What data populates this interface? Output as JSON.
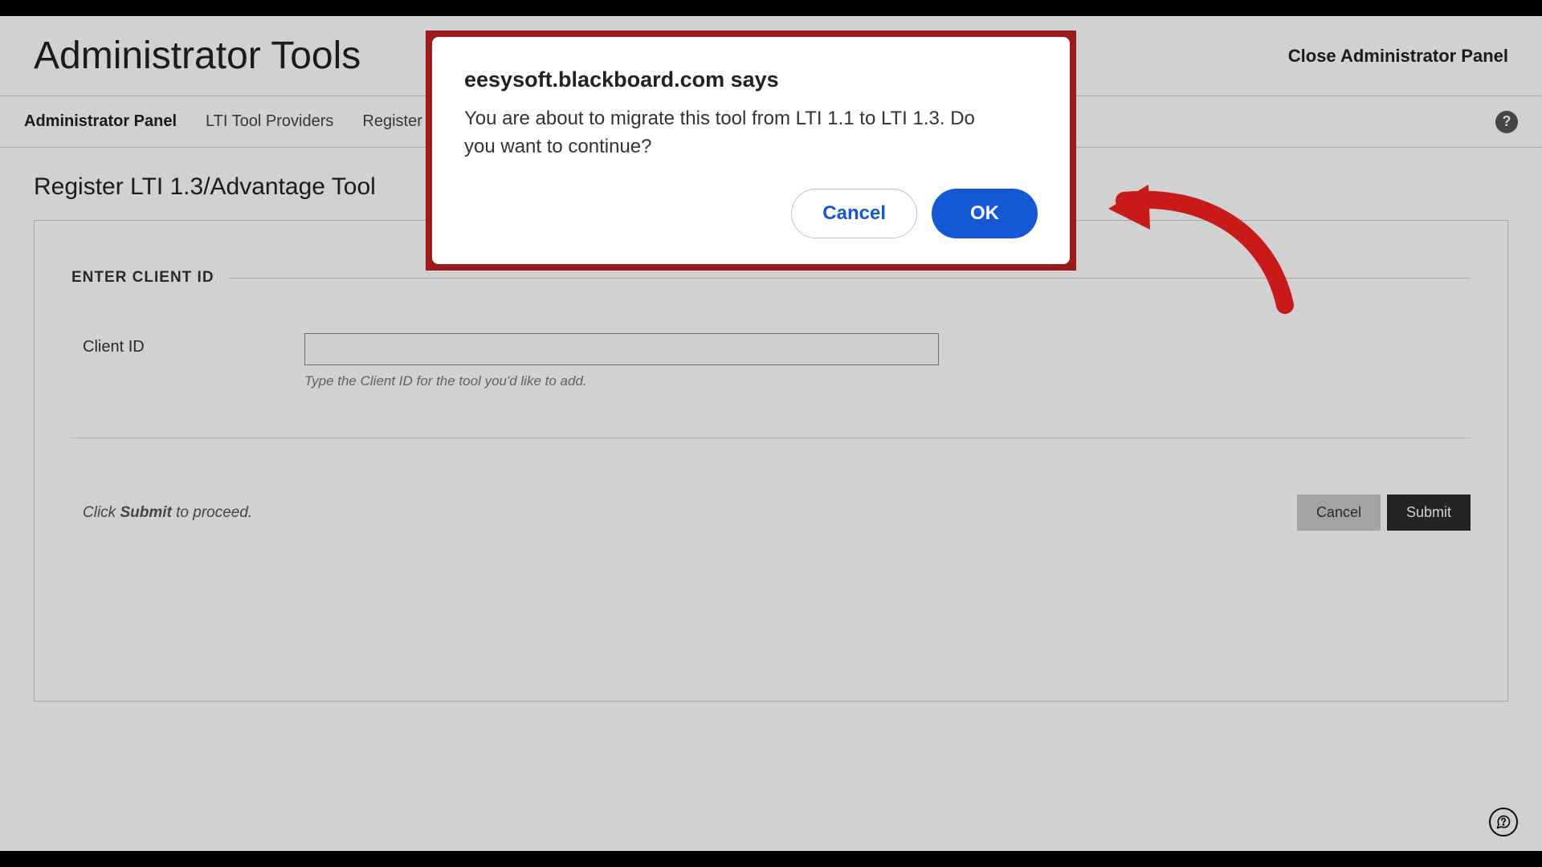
{
  "header": {
    "title": "Administrator Tools",
    "close_label": "Close Administrator Panel"
  },
  "breadcrumbs": {
    "items": [
      {
        "label": "Administrator Panel",
        "current": true
      },
      {
        "label": "LTI Tool Providers",
        "current": false
      },
      {
        "label": "Register LT",
        "current": false
      }
    ],
    "help_glyph": "?"
  },
  "section": {
    "title": "Register LTI 1.3/Advantage Tool"
  },
  "form": {
    "fieldset_label": "ENTER CLIENT ID",
    "client_id_label": "Client ID",
    "client_id_value": "",
    "client_id_hint": "Type the Client ID for the tool you'd like to add.",
    "proceed_note_prefix": "Click ",
    "proceed_note_strong": "Submit",
    "proceed_note_suffix": " to proceed.",
    "cancel_label": "Cancel",
    "submit_label": "Submit"
  },
  "dialog": {
    "title": "eesysoft.blackboard.com says",
    "message": "You are about to migrate this tool from LTI 1.1 to LTI 1.3. Do you want to continue?",
    "cancel_label": "Cancel",
    "ok_label": "OK"
  },
  "annotation": {
    "highlight_color": "#9b1b1b",
    "arrow_color": "#c91a1a"
  }
}
